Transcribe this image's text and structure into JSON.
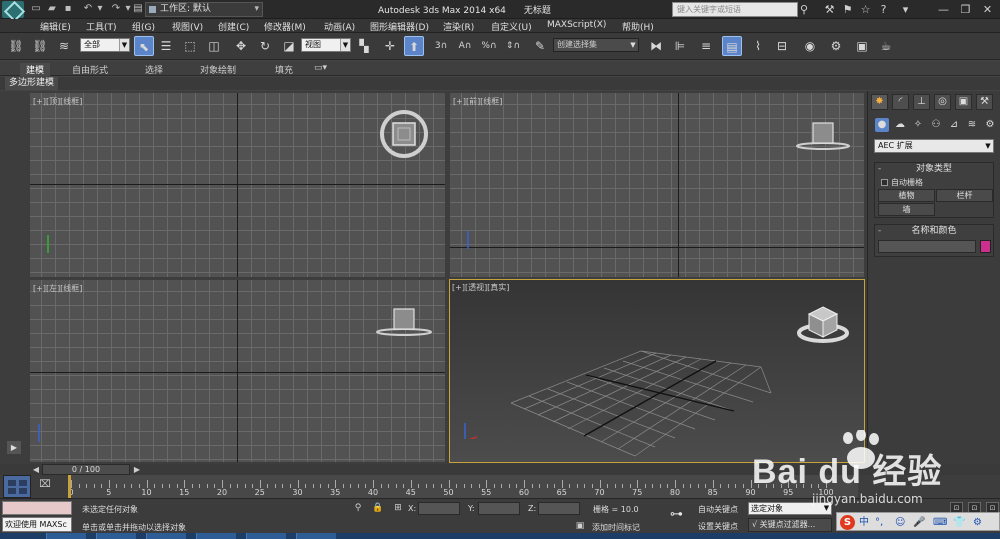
{
  "titlebar": {
    "workspace": "工作区: 默认",
    "app_title": "Autodesk 3ds Max  2014 x64",
    "doc_title": "无标题",
    "search_placeholder": "键入关键字或短语"
  },
  "menu": [
    "编辑(E)",
    "工具(T)",
    "组(G)",
    "视图(V)",
    "创建(C)",
    "修改器(M)",
    "动画(A)",
    "图形编辑器(D)",
    "渲染(R)",
    "自定义(U)",
    "MAXScript(X)",
    "帮助(H)"
  ],
  "toolbar": {
    "selection_filter": "全部",
    "ref_coord": "视图",
    "named_selection": "创建选择集",
    "snap_3": "3",
    "snap_angle": "A",
    "snap_percent": "%"
  },
  "ribbon": {
    "tabs": [
      "建模",
      "自由形式",
      "选择",
      "对象绘制",
      "填充"
    ],
    "sub_label": "多边形建模"
  },
  "viewports": [
    {
      "label": "[+][顶][线框]"
    },
    {
      "label": "[+][前][线框]"
    },
    {
      "label": "[+][左][线框]"
    },
    {
      "label": "[+][透视][真实]"
    }
  ],
  "command_panel": {
    "category": "AEC 扩展",
    "object_type_title": "对象类型",
    "auto_grid": "自动栅格",
    "buttons": [
      "植物",
      "栏杆",
      "墙"
    ],
    "name_color_title": "名称和颜色",
    "swatch_color": "#cc2f8e"
  },
  "timeline": {
    "frame_display": "0 / 100",
    "ticks": [
      0,
      5,
      10,
      15,
      20,
      25,
      30,
      35,
      40,
      45,
      50,
      55,
      60,
      65,
      70,
      75,
      80,
      85,
      90,
      95,
      100
    ]
  },
  "status": {
    "selection": "未选定任何对象",
    "prompt": "单击或单击并拖动以选择对象",
    "welcome": "欢迎使用 MAXSc",
    "x_label": "X:",
    "y_label": "Y:",
    "z_label": "Z:",
    "grid": "栅格 = 10.0",
    "add_time_tag": "添加时间标记",
    "auto_key": "自动关键点",
    "set_key": "设置关键点",
    "selected_dd": "选定对象",
    "key_filters": "关键点过滤器..."
  },
  "watermark": {
    "logo_text": "Bai du 经验",
    "url": "jingyan.baidu.com"
  },
  "ime": {
    "s": "S",
    "chars": [
      "中",
      "°,",
      "☺",
      "🎤",
      "⌨",
      "👕",
      "⚙"
    ]
  }
}
